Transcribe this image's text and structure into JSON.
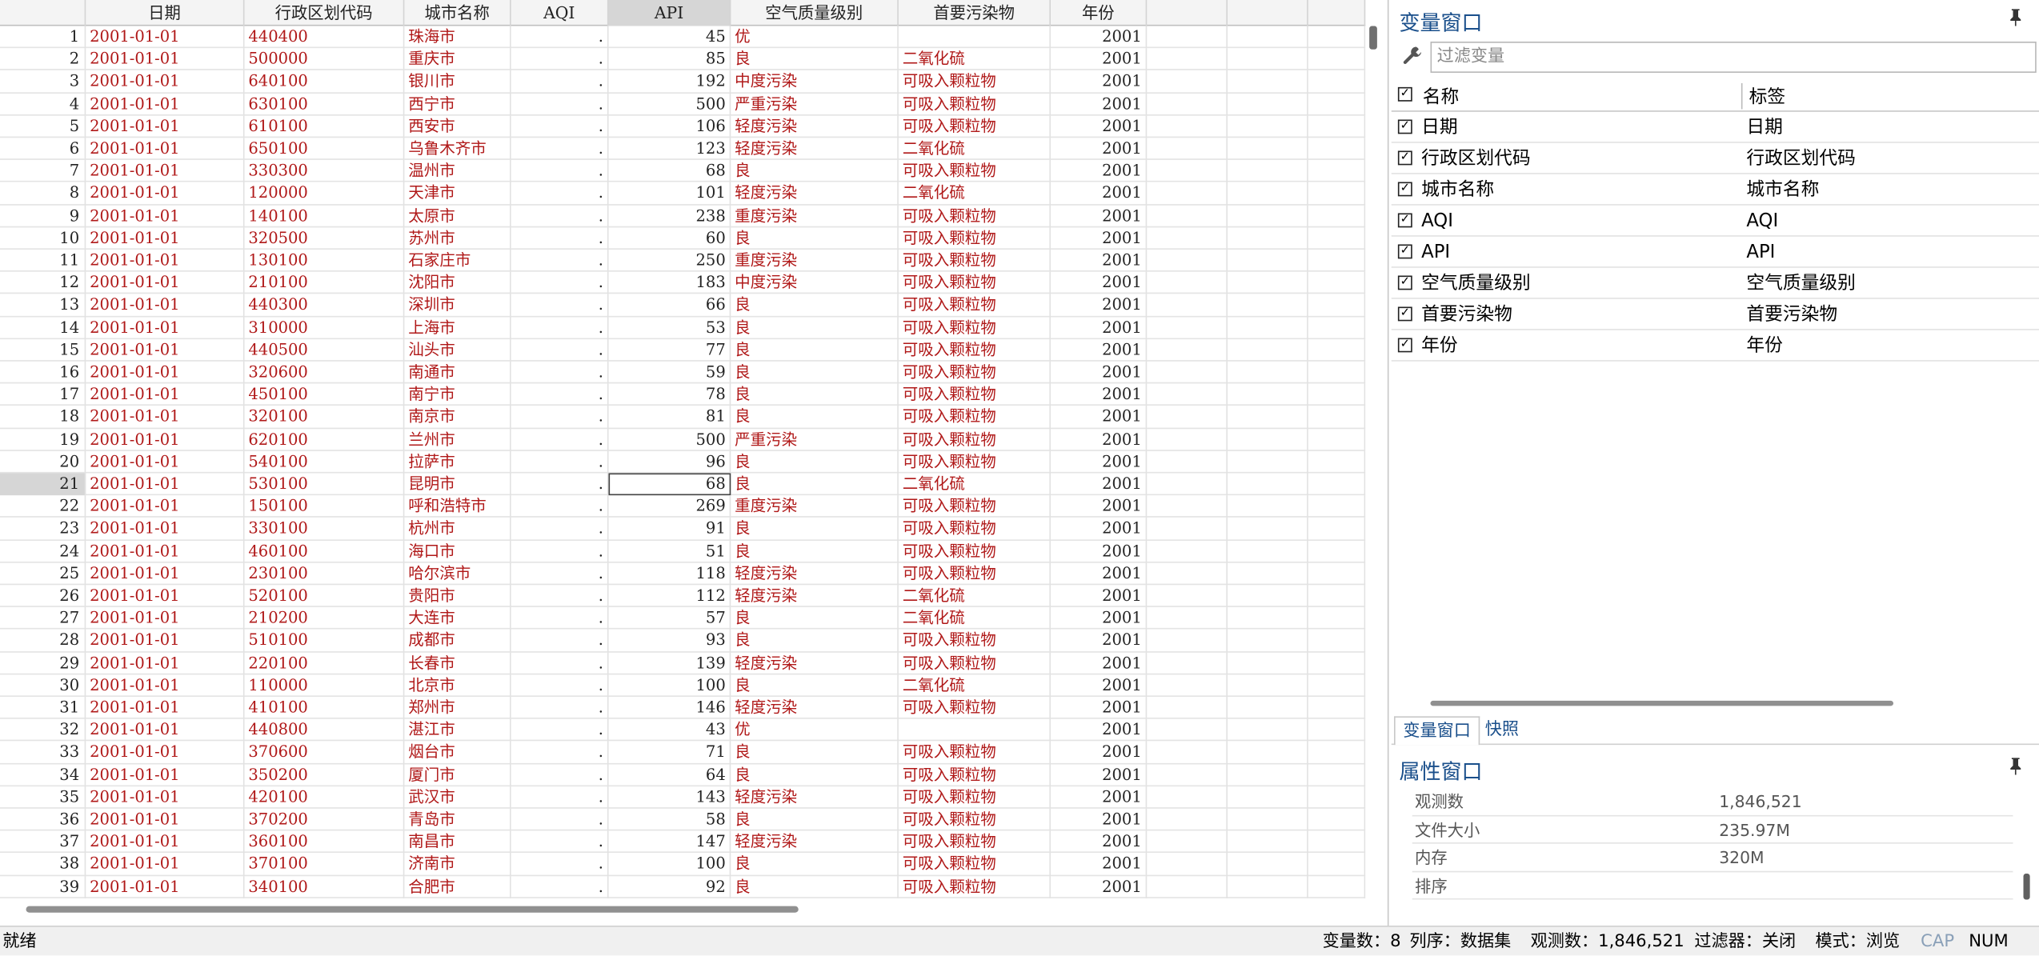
{
  "grid": {
    "columns": [
      "",
      "日期",
      "行政区划代码",
      "城市名称",
      "AQI",
      "API",
      "空气质量级别",
      "首要污染物",
      "年份",
      "",
      "",
      ""
    ],
    "rows": [
      [
        "1",
        "2001-01-01",
        "440400",
        "珠海市",
        ".",
        "45",
        "优",
        "",
        "2001"
      ],
      [
        "2",
        "2001-01-01",
        "500000",
        "重庆市",
        ".",
        "85",
        "良",
        "二氧化硫",
        "2001"
      ],
      [
        "3",
        "2001-01-01",
        "640100",
        "银川市",
        ".",
        "192",
        "中度污染",
        "可吸入颗粒物",
        "2001"
      ],
      [
        "4",
        "2001-01-01",
        "630100",
        "西宁市",
        ".",
        "500",
        "严重污染",
        "可吸入颗粒物",
        "2001"
      ],
      [
        "5",
        "2001-01-01",
        "610100",
        "西安市",
        ".",
        "106",
        "轻度污染",
        "可吸入颗粒物",
        "2001"
      ],
      [
        "6",
        "2001-01-01",
        "650100",
        "乌鲁木齐市",
        ".",
        "123",
        "轻度污染",
        "二氧化硫",
        "2001"
      ],
      [
        "7",
        "2001-01-01",
        "330300",
        "温州市",
        ".",
        "68",
        "良",
        "可吸入颗粒物",
        "2001"
      ],
      [
        "8",
        "2001-01-01",
        "120000",
        "天津市",
        ".",
        "101",
        "轻度污染",
        "二氧化硫",
        "2001"
      ],
      [
        "9",
        "2001-01-01",
        "140100",
        "太原市",
        ".",
        "238",
        "重度污染",
        "可吸入颗粒物",
        "2001"
      ],
      [
        "10",
        "2001-01-01",
        "320500",
        "苏州市",
        ".",
        "60",
        "良",
        "可吸入颗粒物",
        "2001"
      ],
      [
        "11",
        "2001-01-01",
        "130100",
        "石家庄市",
        ".",
        "250",
        "重度污染",
        "可吸入颗粒物",
        "2001"
      ],
      [
        "12",
        "2001-01-01",
        "210100",
        "沈阳市",
        ".",
        "183",
        "中度污染",
        "可吸入颗粒物",
        "2001"
      ],
      [
        "13",
        "2001-01-01",
        "440300",
        "深圳市",
        ".",
        "66",
        "良",
        "可吸入颗粒物",
        "2001"
      ],
      [
        "14",
        "2001-01-01",
        "310000",
        "上海市",
        ".",
        "53",
        "良",
        "可吸入颗粒物",
        "2001"
      ],
      [
        "15",
        "2001-01-01",
        "440500",
        "汕头市",
        ".",
        "77",
        "良",
        "可吸入颗粒物",
        "2001"
      ],
      [
        "16",
        "2001-01-01",
        "320600",
        "南通市",
        ".",
        "59",
        "良",
        "可吸入颗粒物",
        "2001"
      ],
      [
        "17",
        "2001-01-01",
        "450100",
        "南宁市",
        ".",
        "78",
        "良",
        "可吸入颗粒物",
        "2001"
      ],
      [
        "18",
        "2001-01-01",
        "320100",
        "南京市",
        ".",
        "81",
        "良",
        "可吸入颗粒物",
        "2001"
      ],
      [
        "19",
        "2001-01-01",
        "620100",
        "兰州市",
        ".",
        "500",
        "严重污染",
        "可吸入颗粒物",
        "2001"
      ],
      [
        "20",
        "2001-01-01",
        "540100",
        "拉萨市",
        ".",
        "96",
        "良",
        "可吸入颗粒物",
        "2001"
      ],
      [
        "21",
        "2001-01-01",
        "530100",
        "昆明市",
        ".",
        "68",
        "良",
        "二氧化硫",
        "2001"
      ],
      [
        "22",
        "2001-01-01",
        "150100",
        "呼和浩特市",
        ".",
        "269",
        "重度污染",
        "可吸入颗粒物",
        "2001"
      ],
      [
        "23",
        "2001-01-01",
        "330100",
        "杭州市",
        ".",
        "91",
        "良",
        "可吸入颗粒物",
        "2001"
      ],
      [
        "24",
        "2001-01-01",
        "460100",
        "海口市",
        ".",
        "51",
        "良",
        "可吸入颗粒物",
        "2001"
      ],
      [
        "25",
        "2001-01-01",
        "230100",
        "哈尔滨市",
        ".",
        "118",
        "轻度污染",
        "可吸入颗粒物",
        "2001"
      ],
      [
        "26",
        "2001-01-01",
        "520100",
        "贵阳市",
        ".",
        "112",
        "轻度污染",
        "二氧化硫",
        "2001"
      ],
      [
        "27",
        "2001-01-01",
        "210200",
        "大连市",
        ".",
        "57",
        "良",
        "二氧化硫",
        "2001"
      ],
      [
        "28",
        "2001-01-01",
        "510100",
        "成都市",
        ".",
        "93",
        "良",
        "可吸入颗粒物",
        "2001"
      ],
      [
        "29",
        "2001-01-01",
        "220100",
        "长春市",
        ".",
        "139",
        "轻度污染",
        "可吸入颗粒物",
        "2001"
      ],
      [
        "30",
        "2001-01-01",
        "110000",
        "北京市",
        ".",
        "100",
        "良",
        "二氧化硫",
        "2001"
      ],
      [
        "31",
        "2001-01-01",
        "410100",
        "郑州市",
        ".",
        "146",
        "轻度污染",
        "可吸入颗粒物",
        "2001"
      ],
      [
        "32",
        "2001-01-01",
        "440800",
        "湛江市",
        ".",
        "43",
        "优",
        "",
        "2001"
      ],
      [
        "33",
        "2001-01-01",
        "370600",
        "烟台市",
        ".",
        "71",
        "良",
        "可吸入颗粒物",
        "2001"
      ],
      [
        "34",
        "2001-01-01",
        "350200",
        "厦门市",
        ".",
        "64",
        "良",
        "可吸入颗粒物",
        "2001"
      ],
      [
        "35",
        "2001-01-01",
        "420100",
        "武汉市",
        ".",
        "143",
        "轻度污染",
        "可吸入颗粒物",
        "2001"
      ],
      [
        "36",
        "2001-01-01",
        "370200",
        "青岛市",
        ".",
        "58",
        "良",
        "可吸入颗粒物",
        "2001"
      ],
      [
        "37",
        "2001-01-01",
        "360100",
        "南昌市",
        ".",
        "147",
        "轻度污染",
        "可吸入颗粒物",
        "2001"
      ],
      [
        "38",
        "2001-01-01",
        "370100",
        "济南市",
        ".",
        "100",
        "良",
        "可吸入颗粒物",
        "2001"
      ],
      [
        "39",
        "2001-01-01",
        "340100",
        "合肥市",
        ".",
        "92",
        "良",
        "可吸入颗粒物",
        "2001"
      ]
    ],
    "active_row": "21",
    "selected_column": "API"
  },
  "variables_panel": {
    "title": "变量窗口",
    "pin_icon": "pin-icon",
    "filter_placeholder": "过滤变量",
    "header_name": "名称",
    "header_label": "标签",
    "rows": [
      {
        "name": "日期",
        "label": "日期"
      },
      {
        "name": "行政区划代码",
        "label": "行政区划代码"
      },
      {
        "name": "城市名称",
        "label": "城市名称"
      },
      {
        "name": "AQI",
        "label": "AQI"
      },
      {
        "name": "API",
        "label": "API"
      },
      {
        "name": "空气质量级别",
        "label": "空气质量级别"
      },
      {
        "name": "首要污染物",
        "label": "首要污染物"
      },
      {
        "name": "年份",
        "label": "年份"
      }
    ],
    "tabs": [
      "变量窗口",
      "快照"
    ]
  },
  "properties_panel": {
    "title": "属性窗口",
    "rows": [
      {
        "key": "观测数",
        "value": "1,846,521"
      },
      {
        "key": "文件大小",
        "value": "235.97M"
      },
      {
        "key": "内存",
        "value": "320M"
      },
      {
        "key": "排序",
        "value": ""
      }
    ]
  },
  "status_bar": {
    "ready": "就绪",
    "vars": "变量数：8",
    "order": "列序：数据集",
    "obs": "观测数：1,846,521",
    "filter": "过滤器：关闭",
    "mode": "模式：浏览",
    "cap": "CAP",
    "num": "NUM"
  },
  "colors": {
    "accent": "#1a4f8b",
    "string_text": "#b01818"
  }
}
